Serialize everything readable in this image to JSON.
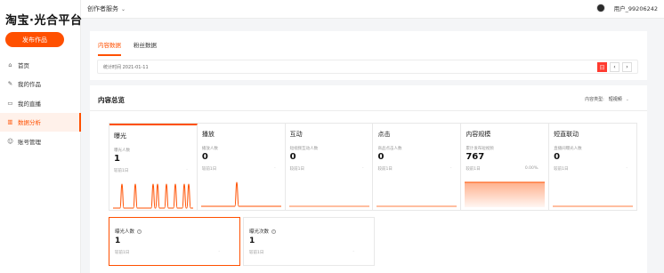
{
  "app": {
    "logo": "淘宝·光合平台"
  },
  "sidebar": {
    "publish_label": "发布作品",
    "items": [
      {
        "label": "首页",
        "icon": "home-icon",
        "glyph": "⌂"
      },
      {
        "label": "我的作品",
        "icon": "pen-icon",
        "glyph": "✎"
      },
      {
        "label": "我的直播",
        "icon": "video-icon",
        "glyph": "▭"
      },
      {
        "label": "数据分析",
        "icon": "chart-icon",
        "glyph": "▥"
      },
      {
        "label": "账号管理",
        "icon": "user-icon",
        "glyph": "☺"
      }
    ],
    "active_index": 3
  },
  "topbar": {
    "service_label": "创作者服务",
    "user_label": "用户_99206242"
  },
  "tabs": [
    {
      "label": "内容数据"
    },
    {
      "label": "粉丝数据"
    }
  ],
  "date": {
    "label": "统计时间 2021-01-11",
    "calendar_glyph": "日",
    "prev_glyph": "‹",
    "next_glyph": "›"
  },
  "overview": {
    "title": "内容总览",
    "filter_label": "内容类型:",
    "filter_value": "短视频",
    "metrics": [
      {
        "title": "曝光",
        "sub": "曝光人数",
        "value": "1",
        "compare": "较前1日",
        "pct": "",
        "spark": [
          0,
          0,
          1,
          0,
          0,
          1,
          0,
          0,
          0,
          1,
          1,
          0,
          1,
          0,
          1,
          0,
          1,
          1,
          0
        ],
        "type": "pulse"
      },
      {
        "title": "播放",
        "sub": "播放人数",
        "value": "0",
        "compare": "较前1日",
        "pct": "",
        "spark": [
          0,
          0,
          0,
          0,
          0,
          0,
          0,
          0,
          1,
          0,
          0,
          0,
          0,
          0,
          0,
          0,
          0,
          0,
          0
        ],
        "type": "pulse"
      },
      {
        "title": "互动",
        "sub": "短视频互动人数",
        "value": "0",
        "compare": "较前1日",
        "pct": "",
        "spark": [],
        "type": "flat"
      },
      {
        "title": "点击",
        "sub": "商品点击人数",
        "value": "0",
        "compare": "较前1日",
        "pct": "",
        "spark": [],
        "type": "flat"
      },
      {
        "title": "内容规模",
        "sub": "累计发布短视频",
        "value": "767",
        "compare": "较前1日",
        "pct": "0.00%",
        "spark": [],
        "type": "area"
      },
      {
        "title": "短直联动",
        "sub": "直播间曝光人数",
        "value": "0",
        "compare": "较前1日",
        "pct": "",
        "spark": [],
        "type": "flat"
      }
    ],
    "active_metric": 0,
    "sub_cards": [
      {
        "title": "曝光人数",
        "value": "1",
        "compare": "较前1日"
      },
      {
        "title": "曝光次数",
        "value": "1",
        "compare": "较前1日"
      }
    ],
    "active_sub_card": 0
  },
  "colors": {
    "accent": "#ff5000",
    "calendar": "#ff3b30"
  }
}
